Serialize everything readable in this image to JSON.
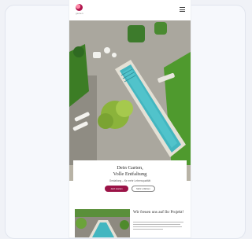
{
  "header": {
    "logo_text": "garten",
    "menu_icon": "hamburger-menu-icon"
  },
  "hero": {
    "title": "Dein Garten,\nVolle Entfaltung",
    "subtitle": "Gestaltung – für mehr Lebensqualität",
    "primary_button": "Jetzt starten",
    "secondary_button": "Mehr erfahren"
  },
  "section": {
    "title": "Wir freuen uns auf Ihr Projekt!"
  },
  "colors": {
    "accent": "#9b1347",
    "pool": "#43b6c0",
    "lawn": "#4f9a2e"
  }
}
